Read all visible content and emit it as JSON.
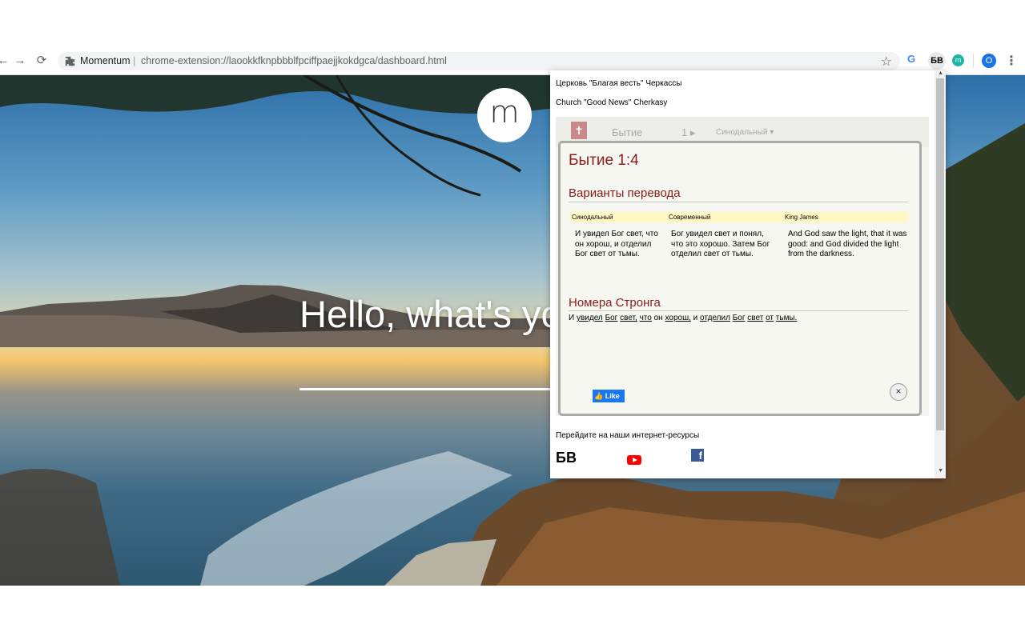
{
  "browser": {
    "omnibox": {
      "extension_name": "Momentum",
      "separator": "|",
      "url": "chrome-extension://laookkfknpbbblfpciffpaejjkokdgca/dashboard.html"
    },
    "extensions": {
      "bv_label": "БВ",
      "momentum_label": "m",
      "profile_initial": "O"
    }
  },
  "momentum": {
    "logo_letter": "m",
    "greeting": "Hello, what's yo"
  },
  "popup": {
    "church_ru": "Церковь \"Благая весть\" Черкассы",
    "church_en": "Church \"Good News\" Cherkasy",
    "widget": {
      "book": "Бытие",
      "chapter": "1 ▸",
      "translation": "Синодальный ▾"
    },
    "verse": {
      "title": "Бытие 1:4",
      "variants_heading": "Варианты перевода",
      "translations": [
        {
          "name": "Синодальный",
          "text": "И увидел Бог свет, что он хорош, и отделил Бог свет от тьмы."
        },
        {
          "name": "Современный",
          "text": "Бог увидел свет и понял, что это хорошо. Затем Бог отделил свет от тьмы."
        },
        {
          "name": "King James",
          "text": "And God saw the light, that it was good: and God divided the light from the darkness."
        }
      ],
      "strong_heading": "Номера Стронга",
      "strong_words": [
        {
          "w": "И",
          "u": false
        },
        {
          "w": "увидел",
          "u": true
        },
        {
          "w": "Бог",
          "u": true
        },
        {
          "w": "свет,",
          "u": true
        },
        {
          "w": "что",
          "u": true
        },
        {
          "w": "он",
          "u": false
        },
        {
          "w": "хорош,",
          "u": true
        },
        {
          "w": "и",
          "u": false
        },
        {
          "w": "отделил",
          "u": true
        },
        {
          "w": "Бог",
          "u": true
        },
        {
          "w": "свет",
          "u": true
        },
        {
          "w": "от",
          "u": true
        },
        {
          "w": "тьмы.",
          "u": true
        }
      ],
      "like_label": "Like",
      "close_symbol": "×"
    },
    "resources_label": "Перейдите на наши интернет-ресурсы",
    "resources_bv_label": "БВ",
    "resources_fb_label": "f"
  }
}
